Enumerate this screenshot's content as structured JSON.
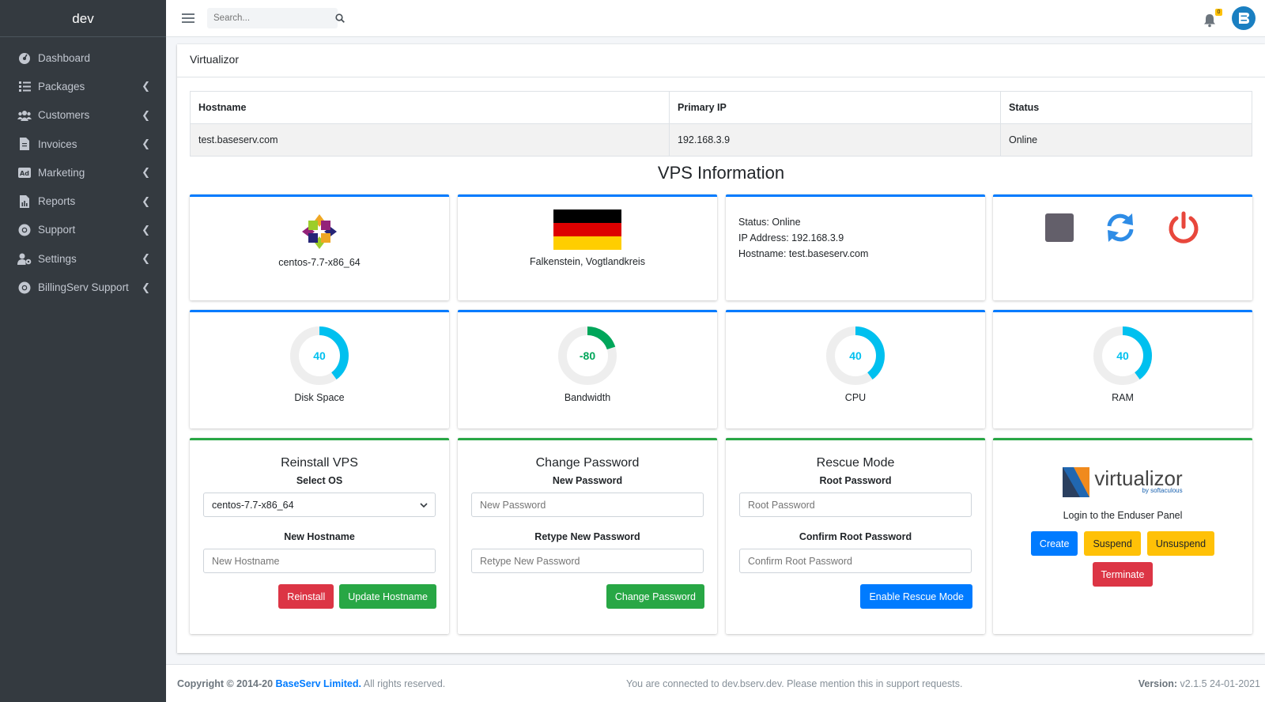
{
  "brand": "dev",
  "sidebar": {
    "items": [
      {
        "label": "Dashboard",
        "icon": "dashboard-icon"
      },
      {
        "label": "Packages",
        "icon": "list-icon"
      },
      {
        "label": "Customers",
        "icon": "users-icon"
      },
      {
        "label": "Invoices",
        "icon": "invoice-icon"
      },
      {
        "label": "Marketing",
        "icon": "ad-icon"
      },
      {
        "label": "Reports",
        "icon": "report-icon"
      },
      {
        "label": "Support",
        "icon": "lifebuoy-icon"
      },
      {
        "label": "Settings",
        "icon": "user-cog-icon"
      },
      {
        "label": "BillingServ Support",
        "icon": "lifebuoy-icon"
      }
    ]
  },
  "topbar": {
    "search_placeholder": "Search...",
    "notification_count": "0"
  },
  "card": {
    "title": "Virtualizor"
  },
  "table": {
    "headers": [
      "Hostname",
      "Primary IP",
      "Status"
    ],
    "row": [
      "test.baseserv.com",
      "192.168.3.9",
      "Online"
    ]
  },
  "vps_title": "VPS Information",
  "os_name": "centos-7.7-x86_64",
  "location": "Falkenstein, Vogtlandkreis",
  "status_info": {
    "status": "Status: Online",
    "ip": "IP Address: 192.168.3.9",
    "hostname": "Hostname: test.baseserv.com"
  },
  "gauges": [
    {
      "label": "Disk Space",
      "value": "40",
      "fraction": 0.4,
      "color": "#00c0ef"
    },
    {
      "label": "Bandwidth",
      "value": "-80",
      "fraction": 0.2,
      "color": "#00a65a"
    },
    {
      "label": "CPU",
      "value": "40",
      "fraction": 0.4,
      "color": "#00c0ef"
    },
    {
      "label": "RAM",
      "value": "40",
      "fraction": 0.4,
      "color": "#00c0ef"
    }
  ],
  "reinstall": {
    "title": "Reinstall VPS",
    "select_label": "Select OS",
    "selected_os": "centos-7.7-x86_64",
    "hostname_label": "New Hostname",
    "hostname_placeholder": "New Hostname",
    "reinstall_btn": "Reinstall",
    "update_btn": "Update Hostname"
  },
  "change_password": {
    "title": "Change Password",
    "new_label": "New Password",
    "new_placeholder": "New Password",
    "retype_label": "Retype New Password",
    "retype_placeholder": "Retype New Password",
    "btn": "Change Password"
  },
  "rescue": {
    "title": "Rescue Mode",
    "root_label": "Root Password",
    "root_placeholder": "Root Password",
    "confirm_label": "Confirm Root Password",
    "confirm_placeholder": "Confirm Root Password",
    "btn": "Enable Rescue Mode"
  },
  "virtualizor": {
    "logo_text": "virtualizor",
    "logo_sub": "by softaculous",
    "login_text": "Login to the Enduser Panel",
    "create": "Create",
    "suspend": "Suspend",
    "unsuspend": "Unsuspend",
    "terminate": "Terminate"
  },
  "footer": {
    "copyright": "Copyright © 2014-20",
    "company": "BaseServ Limited.",
    "rights": "All rights reserved.",
    "connected": "You are connected to dev.bserv.dev. Please mention this in support requests.",
    "version_label": "Version:",
    "version": "v2.1.5 24-01-2021"
  },
  "colors": {
    "sidebar": "#343a40",
    "primary": "#007bff",
    "success": "#28a745",
    "danger": "#dc3545",
    "warning": "#ffc107",
    "info": "#00c0ef"
  }
}
